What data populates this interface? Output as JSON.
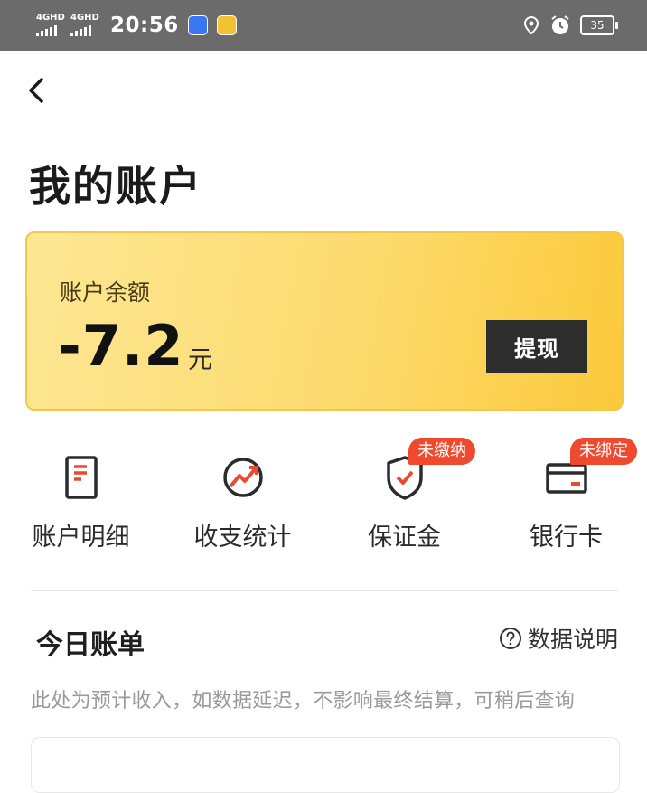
{
  "status_bar": {
    "network_1": "4GHD",
    "network_2": "4GHD",
    "time": "20:56",
    "battery": "35"
  },
  "header": {
    "back_icon": "chevron-left-icon",
    "title": "我的账户"
  },
  "balance_card": {
    "label": "账户余额",
    "amount": "-7.2",
    "unit": "元",
    "withdraw_label": "提现",
    "accent": "#fcd45a"
  },
  "features": [
    {
      "label": "账户明细",
      "icon": "document-icon",
      "badge": ""
    },
    {
      "label": "收支统计",
      "icon": "trend-chart-icon",
      "badge": ""
    },
    {
      "label": "保证金",
      "icon": "shield-check-icon",
      "badge": "未缴纳"
    },
    {
      "label": "银行卡",
      "icon": "bank-card-icon",
      "badge": "未绑定"
    }
  ],
  "today_bill": {
    "title": "今日账单",
    "explain_label": "数据说明",
    "notice": "此处为预计收入，如数据延迟，不影响最终结算，可稍后查询"
  },
  "colors": {
    "badge_red": "#ef4a2f",
    "icon_red": "#ea4b2f",
    "dark_button": "#2d2d2d"
  }
}
